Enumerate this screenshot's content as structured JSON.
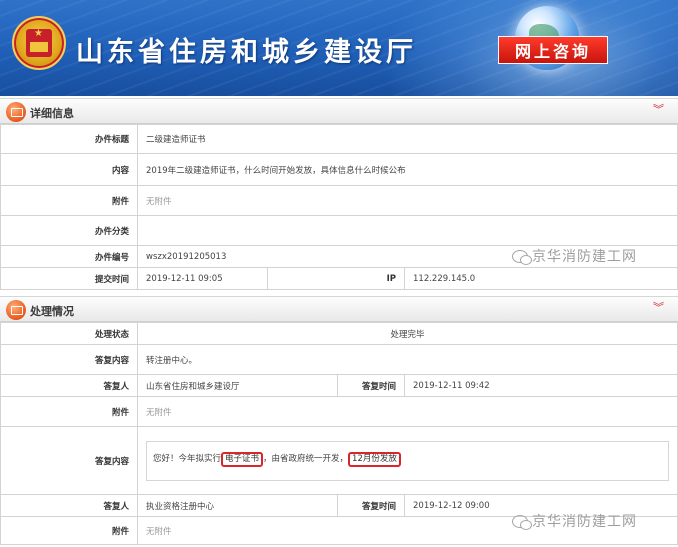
{
  "banner": {
    "site_title": "山东省住房和城乡建设厅",
    "consult_label": "网上咨询"
  },
  "detail": {
    "section_title": "详细信息",
    "rows": {
      "title_label": "办件标题",
      "title_value": "二级建造师证书",
      "content_label": "内容",
      "content_value": "2019年二级建造师证书，什么时间开始发放，具体信息什么时候公布",
      "attach_label": "附件",
      "attach_value": "无附件",
      "category_label": "办件分类",
      "category_value": "",
      "number_label": "办件编号",
      "number_value": "wszx20191205013",
      "submit_label": "提交时间",
      "submit_value": "2019-12-11 09:05",
      "ip_label": "IP",
      "ip_value": "112.229.145.0"
    }
  },
  "process": {
    "section_title": "处理情况",
    "status_label": "处理状态",
    "status_value": "处理完毕",
    "reply1": {
      "content_label": "答复内容",
      "content_value": "转注册中心。",
      "replier_label": "答复人",
      "replier_value": "山东省住房和城乡建设厅",
      "time_label": "答复时间",
      "time_value": "2019-12-11 09:42",
      "attach_label": "附件",
      "attach_value": "无附件"
    },
    "reply2": {
      "content_label": "答复内容",
      "text_part1": "您好！今年拟实行",
      "highlight1": "电子证书",
      "text_part2": "，由省政府统一开发，",
      "highlight2": "12月份发放",
      "replier_label": "答复人",
      "replier_value": "执业资格注册中心",
      "time_label": "答复时间",
      "time_value": "2019-12-12 09:00",
      "attach_label": "附件",
      "attach_value": "无附件"
    }
  },
  "watermark": "京华消防建工网",
  "icons": {
    "section_icon": "envelope-icon",
    "collapse_icon": "double-chevron-icon",
    "watermark_icon": "wechat-icon",
    "emblem": "national-emblem"
  },
  "colors": {
    "banner_blue": "#1f5fb8",
    "consult_red": "#c8140c",
    "highlight_red": "#d9262b"
  }
}
